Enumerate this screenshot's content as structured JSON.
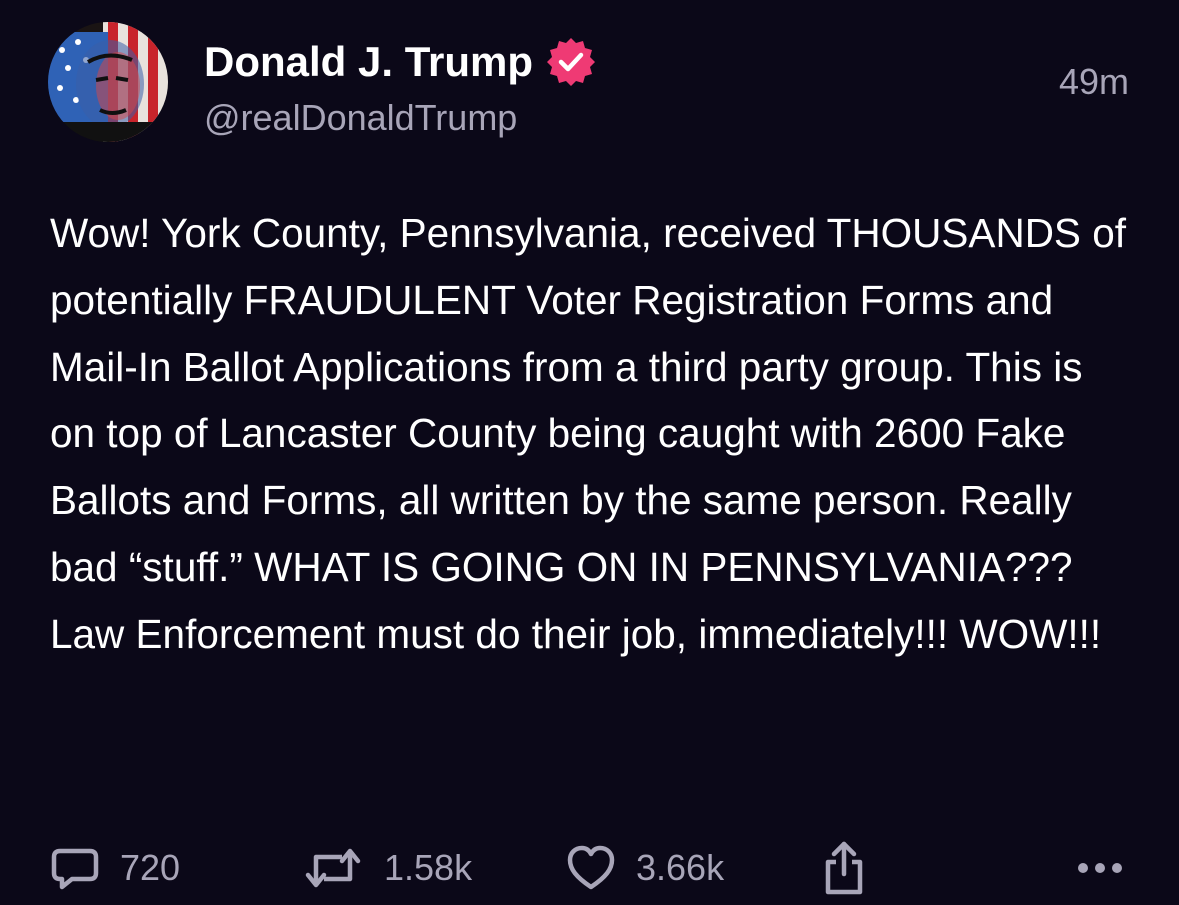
{
  "post": {
    "author": {
      "display_name": "Donald J. Trump",
      "handle": "@realDonaldTrump",
      "verified": true,
      "verified_color": "#ef3a74"
    },
    "timestamp": "49m",
    "body": "Wow! York County, Pennsylvania, received THOUSANDS of potentially FRAUDULENT Voter Registration Forms and Mail-In Ballot Applications from a third party group. This is on top of Lancaster County being caught with 2600 Fake Ballots and Forms, all written by the same person. Really bad “stuff.” WHAT IS GOING ON IN PENNSYLVANIA??? Law Enforcement must do their job, immediately!!! WOW!!!",
    "actions": {
      "reply": {
        "icon": "comment-icon",
        "count": "720"
      },
      "retruth": {
        "icon": "retruth-icon",
        "count": "1.58k"
      },
      "like": {
        "icon": "heart-icon",
        "count": "3.66k"
      },
      "share": {
        "icon": "share-icon"
      },
      "more": {
        "icon": "more-icon"
      }
    }
  },
  "colors": {
    "background": "#0b0818",
    "text": "#ffffff",
    "muted": "#a8a5b8"
  }
}
